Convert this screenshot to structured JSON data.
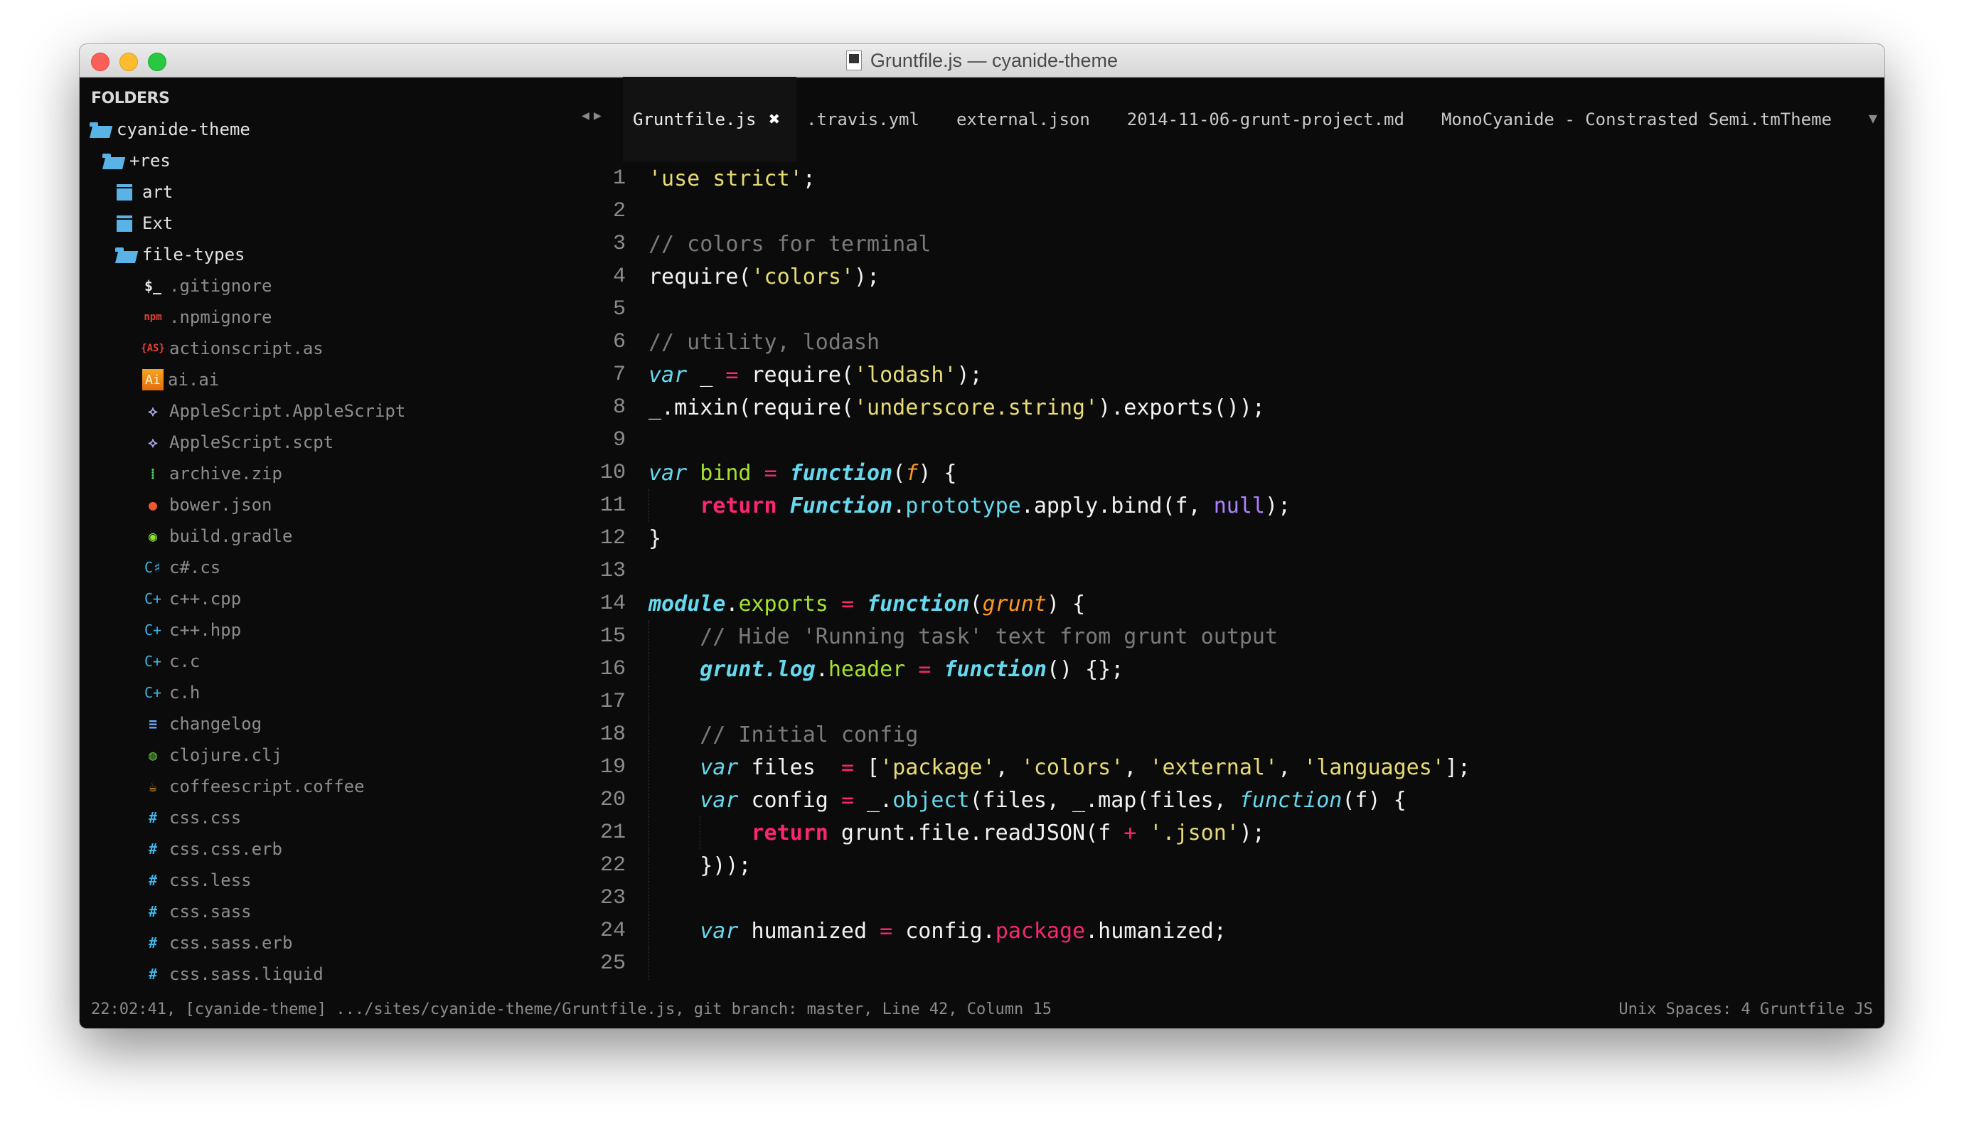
{
  "window": {
    "title": "Gruntfile.js — cyanide-theme",
    "title_icon": "js-document-icon"
  },
  "sidebar": {
    "header": "FOLDERS",
    "tree": [
      {
        "label": "cyanide-theme",
        "icon": "folder-open-icon",
        "depth": 0,
        "type": "folder"
      },
      {
        "label": "+res",
        "icon": "folder-open-icon",
        "depth": 1,
        "type": "folder"
      },
      {
        "label": "art",
        "icon": "folder-closed-icon",
        "depth": 2,
        "type": "folder"
      },
      {
        "label": "Ext",
        "icon": "folder-closed-icon",
        "depth": 2,
        "type": "folder"
      },
      {
        "label": "file-types",
        "icon": "folder-open-icon",
        "depth": 2,
        "type": "folder"
      },
      {
        "label": ".gitignore",
        "icon": "terminal-icon",
        "glyph": "$_",
        "color": "#e8e8e8",
        "depth": 3,
        "type": "file"
      },
      {
        "label": ".npmignore",
        "icon": "npm-icon",
        "glyph": "npm",
        "color": "#e0413a",
        "depth": 3,
        "type": "file"
      },
      {
        "label": "actionscript.as",
        "icon": "actionscript-icon",
        "glyph": "{AS}",
        "color": "#e0413a",
        "depth": 3,
        "type": "file"
      },
      {
        "label": "ai.ai",
        "icon": "illustrator-icon",
        "glyph": "Ai",
        "color": "#f08a17",
        "depth": 3,
        "type": "file"
      },
      {
        "label": "AppleScript.AppleScript",
        "icon": "applescript-icon",
        "glyph": "⟡",
        "color": "#a5a9e0",
        "depth": 3,
        "type": "file"
      },
      {
        "label": "AppleScript.scpt",
        "icon": "applescript-icon",
        "glyph": "⟡",
        "color": "#a5a9e0",
        "depth": 3,
        "type": "file"
      },
      {
        "label": "archive.zip",
        "icon": "zip-icon",
        "glyph": "⁞",
        "color": "#4cd964",
        "depth": 3,
        "type": "file"
      },
      {
        "label": "bower.json",
        "icon": "bower-icon",
        "glyph": "●",
        "color": "#ef5734",
        "depth": 3,
        "type": "file"
      },
      {
        "label": "build.gradle",
        "icon": "gradle-icon",
        "glyph": "◉",
        "color": "#8be23a",
        "depth": 3,
        "type": "file"
      },
      {
        "label": "c#.cs",
        "icon": "csharp-icon",
        "glyph": "C♯",
        "color": "#40b4e6",
        "depth": 3,
        "type": "file"
      },
      {
        "label": "c++.cpp",
        "icon": "cpp-icon",
        "glyph": "C+",
        "color": "#40b4e6",
        "depth": 3,
        "type": "file"
      },
      {
        "label": "c++.hpp",
        "icon": "cpp-icon",
        "glyph": "C+",
        "color": "#40b4e6",
        "depth": 3,
        "type": "file"
      },
      {
        "label": "c.c",
        "icon": "c-icon",
        "glyph": "C+",
        "color": "#40b4e6",
        "depth": 3,
        "type": "file"
      },
      {
        "label": "c.h",
        "icon": "c-icon",
        "glyph": "C+",
        "color": "#40b4e6",
        "depth": 3,
        "type": "file"
      },
      {
        "label": "changelog",
        "icon": "text-lines-icon",
        "glyph": "≡",
        "color": "#6fa8f0",
        "depth": 3,
        "type": "file"
      },
      {
        "label": "clojure.clj",
        "icon": "clojure-icon",
        "glyph": "◍",
        "color": "#5fb236",
        "depth": 3,
        "type": "file"
      },
      {
        "label": "coffeescript.coffee",
        "icon": "coffee-icon",
        "glyph": "☕",
        "color": "#f0a030",
        "depth": 3,
        "type": "file"
      },
      {
        "label": "css.css",
        "icon": "css-hash-icon",
        "glyph": "#",
        "color": "#40b4e6",
        "depth": 3,
        "type": "file"
      },
      {
        "label": "css.css.erb",
        "icon": "css-hash-icon",
        "glyph": "#",
        "color": "#40b4e6",
        "depth": 3,
        "type": "file"
      },
      {
        "label": "css.less",
        "icon": "css-hash-icon",
        "glyph": "#",
        "color": "#40b4e6",
        "depth": 3,
        "type": "file"
      },
      {
        "label": "css.sass",
        "icon": "css-hash-icon",
        "glyph": "#",
        "color": "#40b4e6",
        "depth": 3,
        "type": "file"
      },
      {
        "label": "css.sass.erb",
        "icon": "css-hash-icon",
        "glyph": "#",
        "color": "#40b4e6",
        "depth": 3,
        "type": "file"
      },
      {
        "label": "css.sass.liquid",
        "icon": "css-hash-icon",
        "glyph": "#",
        "color": "#40b4e6",
        "depth": 3,
        "type": "file"
      }
    ]
  },
  "tabs": {
    "nav_prev": "◀",
    "nav_next": "▶",
    "dropdown": "▼",
    "close_glyph": "✖",
    "items": [
      {
        "label": "Gruntfile.js",
        "active": true
      },
      {
        "label": ".travis.yml",
        "active": false
      },
      {
        "label": "external.json",
        "active": false
      },
      {
        "label": "2014-11-06-grunt-project.md",
        "active": false
      },
      {
        "label": "MonoCyanide - Constrasted Semi.tmTheme",
        "active": false
      }
    ]
  },
  "editor": {
    "colors": {
      "string": "#e6db74",
      "comment": "#7a7a7a",
      "keyword": "#66d9ef",
      "operator": "#f92672",
      "entity": "#a6e22e",
      "parameter": "#fd971f",
      "constant": "#ae81ff"
    },
    "lines": [
      {
        "n": "1",
        "tokens": [
          [
            "str",
            "'use strict'"
          ],
          [
            "plain",
            ";"
          ]
        ]
      },
      {
        "n": "2",
        "tokens": []
      },
      {
        "n": "3",
        "tokens": [
          [
            "com",
            "// colors for terminal"
          ]
        ]
      },
      {
        "n": "4",
        "tokens": [
          [
            "plain",
            "require("
          ],
          [
            "str",
            "'colors'"
          ],
          [
            "plain",
            ");"
          ]
        ]
      },
      {
        "n": "5",
        "tokens": []
      },
      {
        "n": "6",
        "tokens": [
          [
            "com",
            "// utility, lodash"
          ]
        ]
      },
      {
        "n": "7",
        "tokens": [
          [
            "kw",
            "var"
          ],
          [
            "plain",
            " _ "
          ],
          [
            "op",
            "="
          ],
          [
            "plain",
            " require("
          ],
          [
            "str",
            "'lodash'"
          ],
          [
            "plain",
            ");"
          ]
        ]
      },
      {
        "n": "8",
        "tokens": [
          [
            "plain",
            "_.mixin(require("
          ],
          [
            "str",
            "'underscore.string'"
          ],
          [
            "plain",
            ").exports());"
          ]
        ]
      },
      {
        "n": "9",
        "tokens": []
      },
      {
        "n": "10",
        "tokens": [
          [
            "kw",
            "var"
          ],
          [
            "plain",
            " "
          ],
          [
            "green",
            "bind"
          ],
          [
            "plain",
            " "
          ],
          [
            "op",
            "="
          ],
          [
            "plain",
            " "
          ],
          [
            "fn",
            "function"
          ],
          [
            "plain",
            "("
          ],
          [
            "param",
            "f"
          ],
          [
            "plain",
            ") {"
          ]
        ]
      },
      {
        "n": "11",
        "indent": 1,
        "tokens": [
          [
            "ret",
            "return"
          ],
          [
            "plain",
            " "
          ],
          [
            "fn",
            "Function"
          ],
          [
            "plain",
            "."
          ],
          [
            "prop",
            "prototype"
          ],
          [
            "plain",
            ".apply.bind(f, "
          ],
          [
            "const",
            "null"
          ],
          [
            "plain",
            ");"
          ]
        ]
      },
      {
        "n": "12",
        "tokens": [
          [
            "plain",
            "}"
          ]
        ]
      },
      {
        "n": "13",
        "tokens": []
      },
      {
        "n": "14",
        "tokens": [
          [
            "fn",
            "module"
          ],
          [
            "plain",
            "."
          ],
          [
            "green",
            "exports"
          ],
          [
            "plain",
            " "
          ],
          [
            "op",
            "="
          ],
          [
            "plain",
            " "
          ],
          [
            "fn",
            "function"
          ],
          [
            "plain",
            "("
          ],
          [
            "param",
            "grunt"
          ],
          [
            "plain",
            ") {"
          ]
        ]
      },
      {
        "n": "15",
        "indent": 1,
        "tokens": [
          [
            "com",
            "// Hide 'Running task' text from grunt output"
          ]
        ]
      },
      {
        "n": "16",
        "indent": 1,
        "tokens": [
          [
            "fn",
            "grunt.log"
          ],
          [
            "plain",
            "."
          ],
          [
            "green",
            "header"
          ],
          [
            "plain",
            " "
          ],
          [
            "op",
            "="
          ],
          [
            "plain",
            " "
          ],
          [
            "fn",
            "function"
          ],
          [
            "plain",
            "() {};"
          ]
        ]
      },
      {
        "n": "17",
        "indent": 1,
        "tokens": []
      },
      {
        "n": "18",
        "indent": 1,
        "tokens": [
          [
            "com",
            "// Initial config"
          ]
        ]
      },
      {
        "n": "19",
        "indent": 1,
        "tokens": [
          [
            "kw",
            "var"
          ],
          [
            "plain",
            " files  "
          ],
          [
            "op",
            "="
          ],
          [
            "plain",
            " ["
          ],
          [
            "str",
            "'package'"
          ],
          [
            "plain",
            ", "
          ],
          [
            "str",
            "'colors'"
          ],
          [
            "plain",
            ", "
          ],
          [
            "str",
            "'external'"
          ],
          [
            "plain",
            ", "
          ],
          [
            "str",
            "'languages'"
          ],
          [
            "plain",
            "];"
          ]
        ]
      },
      {
        "n": "20",
        "indent": 1,
        "tokens": [
          [
            "kw",
            "var"
          ],
          [
            "plain",
            " config "
          ],
          [
            "op",
            "="
          ],
          [
            "plain",
            " _."
          ],
          [
            "prop",
            "object"
          ],
          [
            "plain",
            "(files, _.map(files, "
          ],
          [
            "kw",
            "function"
          ],
          [
            "plain",
            "(f) {"
          ]
        ]
      },
      {
        "n": "21",
        "indent": 2,
        "tokens": [
          [
            "ret",
            "return"
          ],
          [
            "plain",
            " grunt.file.readJSON(f "
          ],
          [
            "op",
            "+"
          ],
          [
            "plain",
            " "
          ],
          [
            "str",
            "'.json'"
          ],
          [
            "plain",
            ");"
          ]
        ]
      },
      {
        "n": "22",
        "indent": 1,
        "tokens": [
          [
            "plain",
            "}));"
          ]
        ]
      },
      {
        "n": "23",
        "indent": 1,
        "tokens": []
      },
      {
        "n": "24",
        "indent": 1,
        "tokens": [
          [
            "kw",
            "var"
          ],
          [
            "plain",
            " humanized "
          ],
          [
            "op",
            "="
          ],
          [
            "plain",
            " config."
          ],
          [
            "pink",
            "package"
          ],
          [
            "plain",
            ".humanized;"
          ]
        ]
      },
      {
        "n": "25",
        "indent": 1,
        "tokens": []
      }
    ]
  },
  "statusbar": {
    "left": "22:02:41, [cyanide-theme] .../sites/cyanide-theme/Gruntfile.js, git branch: master, Line 42, Column 15",
    "right": "Unix Spaces: 4 Gruntfile JS"
  }
}
